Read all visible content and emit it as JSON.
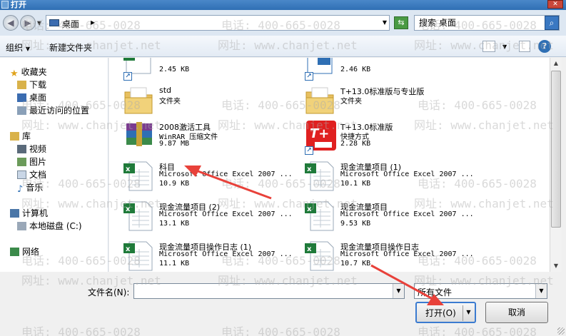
{
  "window": {
    "title": "打开"
  },
  "address": {
    "location": "桌面",
    "search_placeholder": "搜索 桌面"
  },
  "toolbar": {
    "organize": "组织",
    "new_folder": "新建文件夹"
  },
  "nav": {
    "favorites": "收藏夹",
    "downloads": "下载",
    "desktop": "桌面",
    "recent": "最近访问的位置",
    "libraries": "库",
    "videos": "视频",
    "pictures": "图片",
    "documents": "文档",
    "music": "音乐",
    "computer": "计算机",
    "local_disk": "本地磁盘 (C:)",
    "network": "网络"
  },
  "files": [
    {
      "name": "",
      "type": "",
      "size": "2.45 KB",
      "icon": "excel-shortcut-icon"
    },
    {
      "name": "",
      "type": "",
      "size": "2.46 KB",
      "icon": "shortcut-icon"
    },
    {
      "name": "std",
      "type": "文件夹",
      "size": "",
      "icon": "folder-icon"
    },
    {
      "name": "T+13.0标准版与专业版",
      "type": "文件夹",
      "size": "",
      "icon": "folder-icon"
    },
    {
      "name": "2008激活工具",
      "type": "WinRAR 压缩文件",
      "size": "9.87 MB",
      "icon": "winrar-icon"
    },
    {
      "name": "T+13.0标准版",
      "type": "快捷方式",
      "size": "2.28 KB",
      "icon": "tplus-icon"
    },
    {
      "name": "科目",
      "type": "Microsoft Office Excel 2007 ...",
      "size": "10.9 KB",
      "icon": "excel-icon"
    },
    {
      "name": "现金流量项目 (1)",
      "type": "Microsoft Office Excel 2007 ...",
      "size": "10.1 KB",
      "icon": "excel-icon"
    },
    {
      "name": "现金流量项目 (2)",
      "type": "Microsoft Office Excel 2007 ...",
      "size": "13.1 KB",
      "icon": "excel-icon"
    },
    {
      "name": "现金流量项目",
      "type": "Microsoft Office Excel 2007 ...",
      "size": "9.53 KB",
      "icon": "excel-icon"
    },
    {
      "name": "现金流量项目操作日志 (1)",
      "type": "Microsoft Office Excel 2007 ...",
      "size": "11.1 KB",
      "icon": "excel-icon"
    },
    {
      "name": "现金流量项目操作日志",
      "type": "Microsoft Office Excel 2007 ...",
      "size": "10.7 KB",
      "icon": "excel-icon"
    }
  ],
  "tplus_badge": "T+",
  "bottom": {
    "filename_label": "文件名(N):",
    "filename_value": "",
    "filetype_value": "所有文件",
    "open_label": "打开(O)",
    "cancel_label": "取消"
  },
  "watermark": {
    "phone": "电话: 400-665-0028",
    "site": "网址: www.chanjet.net"
  },
  "colors": {
    "annotation_red": "#e8413a",
    "accent_blue": "#2f6fb4"
  }
}
